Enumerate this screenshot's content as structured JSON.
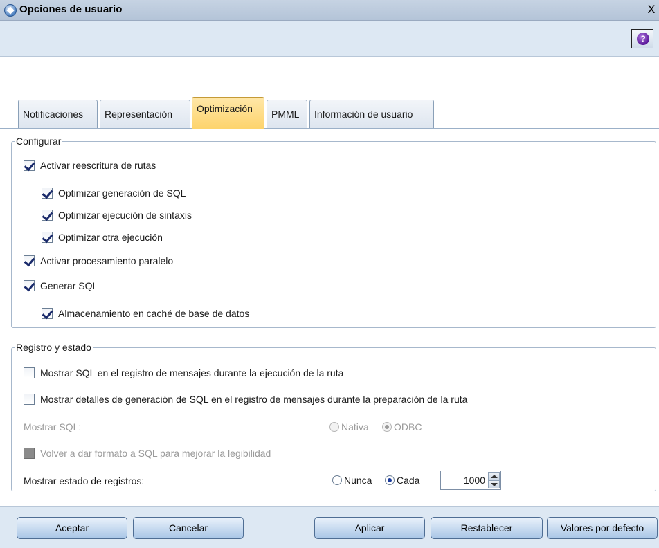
{
  "window": {
    "title": "Opciones de usuario",
    "close_glyph": "X",
    "icon": "app-diamond-icon"
  },
  "toolbar": {
    "help_glyph": "?",
    "help_icon": "help-icon"
  },
  "tabs": [
    {
      "label": "Notificaciones",
      "active": false
    },
    {
      "label": "Representación",
      "active": false
    },
    {
      "label": "Optimización",
      "active": true
    },
    {
      "label": "PMML",
      "active": false
    },
    {
      "label": "Información de usuario",
      "active": false
    }
  ],
  "configurar": {
    "legend": "Configurar",
    "items": [
      {
        "label": "Activar reescritura de rutas",
        "checked": true
      },
      {
        "label": "Optimizar generación de SQL",
        "checked": true
      },
      {
        "label": "Optimizar ejecución de sintaxis",
        "checked": true
      },
      {
        "label": "Optimizar otra ejecución",
        "checked": true
      },
      {
        "label": "Activar procesamiento paralelo",
        "checked": true
      },
      {
        "label": "Generar SQL",
        "checked": true
      },
      {
        "label": "Almacenamiento en caché de base de datos",
        "checked": true
      }
    ]
  },
  "registro": {
    "legend": "Registro y estado",
    "show_sql_log": {
      "label": "Mostrar SQL en el registro de mensajes durante la ejecución de la ruta",
      "checked": false
    },
    "show_sql_details": {
      "label": "Mostrar detalles de generación de SQL en el registro de mensajes durante la preparación de la ruta",
      "checked": false
    },
    "mostrar_sql": {
      "label": "Mostrar SQL:",
      "options": [
        "Nativa",
        "ODBC"
      ],
      "selected": "ODBC",
      "disabled": true
    },
    "reformat": {
      "label": "Volver a dar formato a SQL para mejorar la legibilidad",
      "checked": false,
      "disabled": true
    },
    "estado": {
      "label": "Mostrar estado de registros:",
      "options": [
        "Nunca",
        "Cada"
      ],
      "selected": "Cada",
      "value": "1000"
    }
  },
  "buttons": {
    "aceptar": "Aceptar",
    "cancelar": "Cancelar",
    "aplicar": "Aplicar",
    "restablecer": "Restablecer",
    "valores": "Valores por defecto"
  },
  "colors": {
    "active_tab": "#fdd36b",
    "chrome": "#dde8f3",
    "check": "#1a2a6b"
  }
}
